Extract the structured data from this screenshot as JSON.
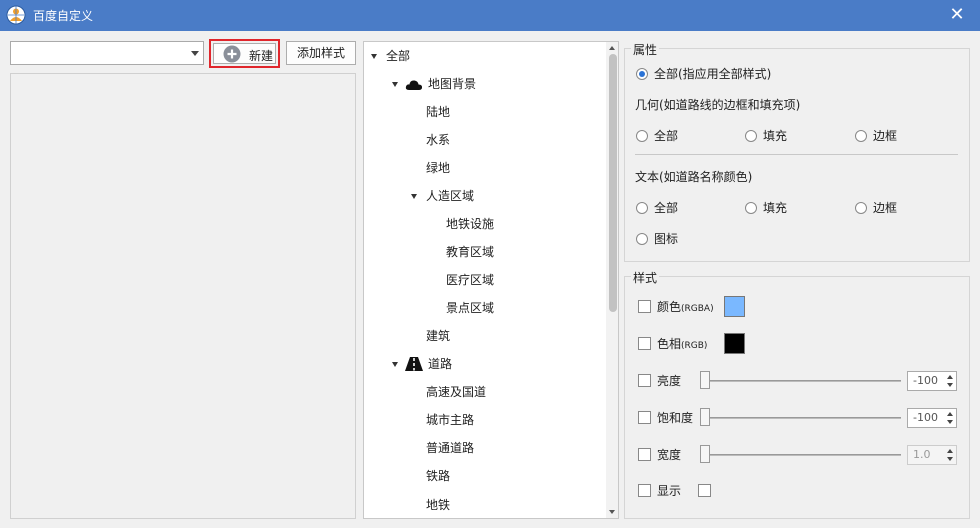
{
  "window": {
    "title": "百度自定义",
    "close_glyph": "✕",
    "icon": "globe-user-icon"
  },
  "toolbar": {
    "dropdown_value": "",
    "new_label": "新建",
    "add_style_label": "添加样式"
  },
  "tree": {
    "root": "全部",
    "map_background": "地图背景",
    "land": "陆地",
    "water": "水系",
    "green": "绿地",
    "artificial": "人造区域",
    "subway_facility": "地铁设施",
    "education": "教育区域",
    "medical": "医疗区域",
    "scenic": "景点区域",
    "building": "建筑",
    "road": "道路",
    "highway": "高速及国道",
    "city_main": "城市主路",
    "normal_road": "普通道路",
    "railway": "铁路",
    "subway": "地铁"
  },
  "properties": {
    "title": "属性",
    "all_label": "全部(指应用全部样式)",
    "geometry_title": "几何(如道路线的边框和填充项)",
    "geo_all": "全部",
    "geo_fill": "填充",
    "geo_border": "边框",
    "text_title": "文本(如道路名称颜色)",
    "text_all": "全部",
    "text_fill": "填充",
    "text_border": "边框",
    "text_icon": "图标"
  },
  "style": {
    "title": "样式",
    "color_label": "颜色",
    "color_suffix": "(RGBA)",
    "color_value": "#7ab8ff",
    "hue_label": "色相",
    "hue_suffix": "(RGB)",
    "hue_value": "#000000",
    "brightness_label": "亮度",
    "brightness_value": "-100",
    "saturation_label": "饱和度",
    "saturation_value": "-100",
    "width_label": "宽度",
    "width_value": "1.0",
    "visible_label": "显示"
  }
}
